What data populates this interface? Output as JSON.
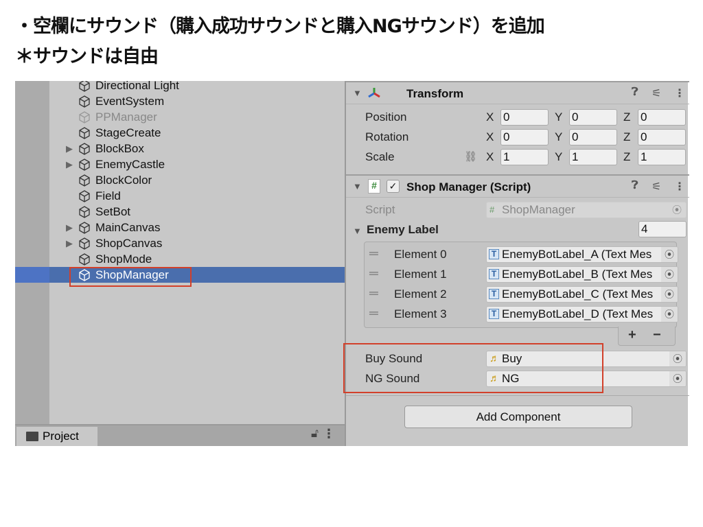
{
  "notes": {
    "line1": "・空欄にサウンド（購入成功サウンドと購入NGサウンド）を追加",
    "line2": "＊サウンドは自由"
  },
  "hierarchy": {
    "items": [
      {
        "label": "Directional Light",
        "expand": false,
        "dim": false
      },
      {
        "label": "EventSystem",
        "expand": false,
        "dim": false
      },
      {
        "label": "PPManager",
        "expand": false,
        "dim": true
      },
      {
        "label": "StageCreate",
        "expand": false,
        "dim": false
      },
      {
        "label": "BlockBox",
        "expand": true,
        "dim": false
      },
      {
        "label": "EnemyCastle",
        "expand": true,
        "dim": false
      },
      {
        "label": "BlockColor",
        "expand": false,
        "dim": false
      },
      {
        "label": "Field",
        "expand": false,
        "dim": false
      },
      {
        "label": "SetBot",
        "expand": false,
        "dim": false
      },
      {
        "label": "MainCanvas",
        "expand": true,
        "dim": false
      },
      {
        "label": "ShopCanvas",
        "expand": true,
        "dim": false
      },
      {
        "label": "ShopMode",
        "expand": false,
        "dim": false
      },
      {
        "label": "ShopManager",
        "expand": false,
        "dim": false,
        "selected": true
      }
    ],
    "project_tab": "Project"
  },
  "inspector": {
    "transform": {
      "title": "Transform",
      "rows": [
        {
          "label": "Position",
          "x": "0",
          "y": "0",
          "z": "0"
        },
        {
          "label": "Rotation",
          "x": "0",
          "y": "0",
          "z": "0"
        },
        {
          "label": "Scale",
          "x": "1",
          "y": "1",
          "z": "1"
        }
      ]
    },
    "script": {
      "title": "Shop Manager (Script)",
      "enabled": true,
      "script_label": "Script",
      "script_value": "ShopManager",
      "enemy_label": "Enemy Label",
      "count": "4",
      "elements": [
        {
          "label": "Element 0",
          "value": "EnemyBotLabel_A (Text Mes"
        },
        {
          "label": "Element 1",
          "value": "EnemyBotLabel_B (Text Mes"
        },
        {
          "label": "Element 2",
          "value": "EnemyBotLabel_C (Text Mes"
        },
        {
          "label": "Element 3",
          "value": "EnemyBotLabel_D (Text Mes"
        }
      ],
      "buy_sound_label": "Buy Sound",
      "buy_sound_value": "Buy",
      "ng_sound_label": "NG Sound",
      "ng_sound_value": "NG"
    },
    "add_component": "Add Component"
  },
  "colors": {
    "highlight": "#d2402a",
    "selection": "#4a6ead"
  }
}
